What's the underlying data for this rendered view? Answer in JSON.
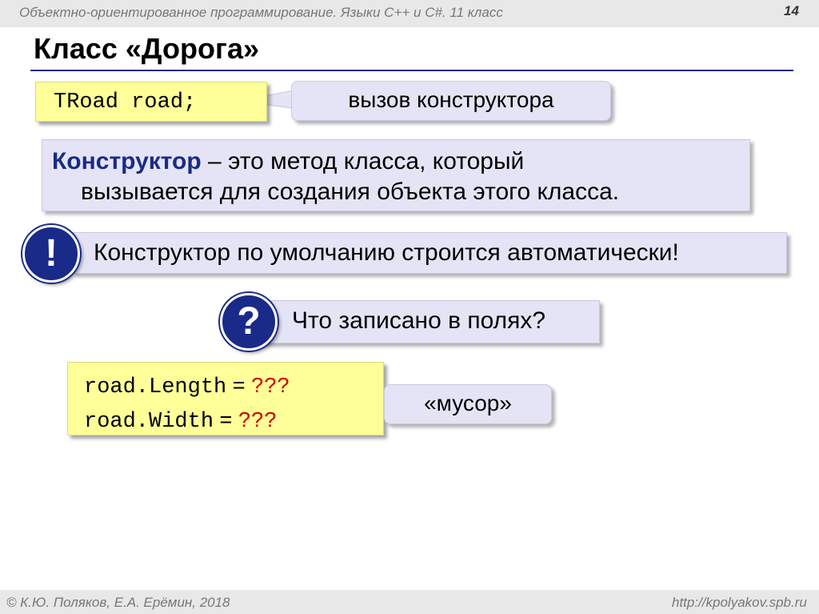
{
  "header": {
    "course": "Объектно-ориентированное программирование. Языки C++ и C#. 11 класс",
    "page_number": "14"
  },
  "title": "Класс «Дорога»",
  "code_decl": "TRoad road;",
  "callout_constructor_call": "вызов конструктора",
  "definition": {
    "term": "Конструктор",
    "line1_rest": " – это метод класса, который",
    "line2": "вызывается для создания объекта этого класса."
  },
  "note": {
    "icon": "!",
    "text": "Конструктор по умолчанию строится автоматически!"
  },
  "question": {
    "icon": "?",
    "text": "Что записано в полях?"
  },
  "code_fields": [
    {
      "name": "road.Length",
      "eq": " = ",
      "value": "???"
    },
    {
      "name": "road.Width",
      "eq": " = ",
      "value": "???"
    }
  ],
  "callout_garbage": "«мусор»",
  "footer": {
    "copyright": "© К.Ю. Поляков, Е.А. Ерёмин, 2018",
    "url": "http://kpolyakov.spb.ru"
  },
  "colors": {
    "accent": "#1a2a88",
    "code_bg": "#ffff99",
    "callout_bg": "#e4e4f6",
    "question_marks": "#cc0000"
  }
}
